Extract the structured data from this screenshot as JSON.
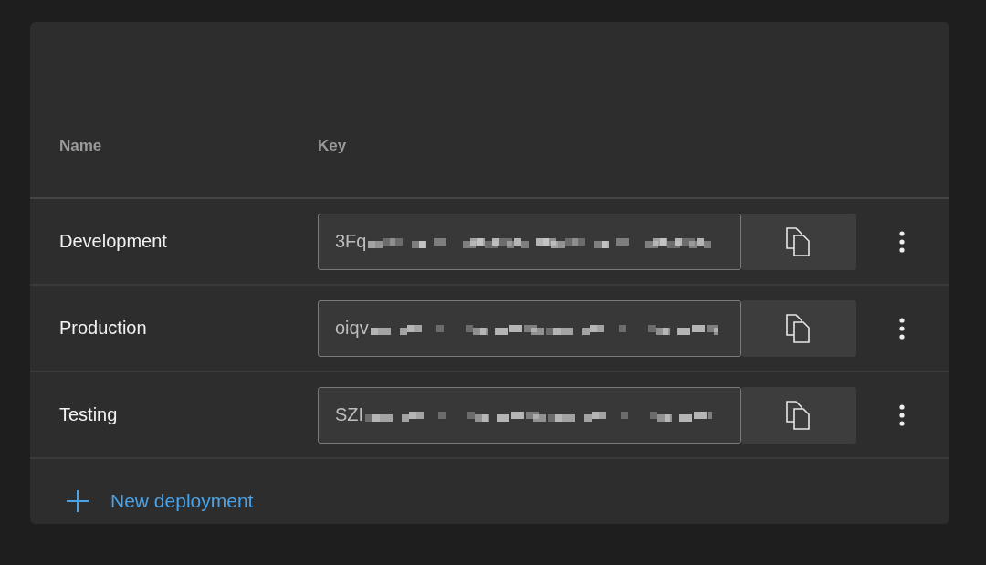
{
  "table": {
    "columns": [
      "Name",
      "Key"
    ],
    "rows": [
      {
        "name": "Development",
        "key": "3Fq"
      },
      {
        "name": "Production",
        "key": "oiqv"
      },
      {
        "name": "Testing",
        "key": "SZI"
      }
    ]
  },
  "add_button": {
    "label": "New deployment"
  }
}
